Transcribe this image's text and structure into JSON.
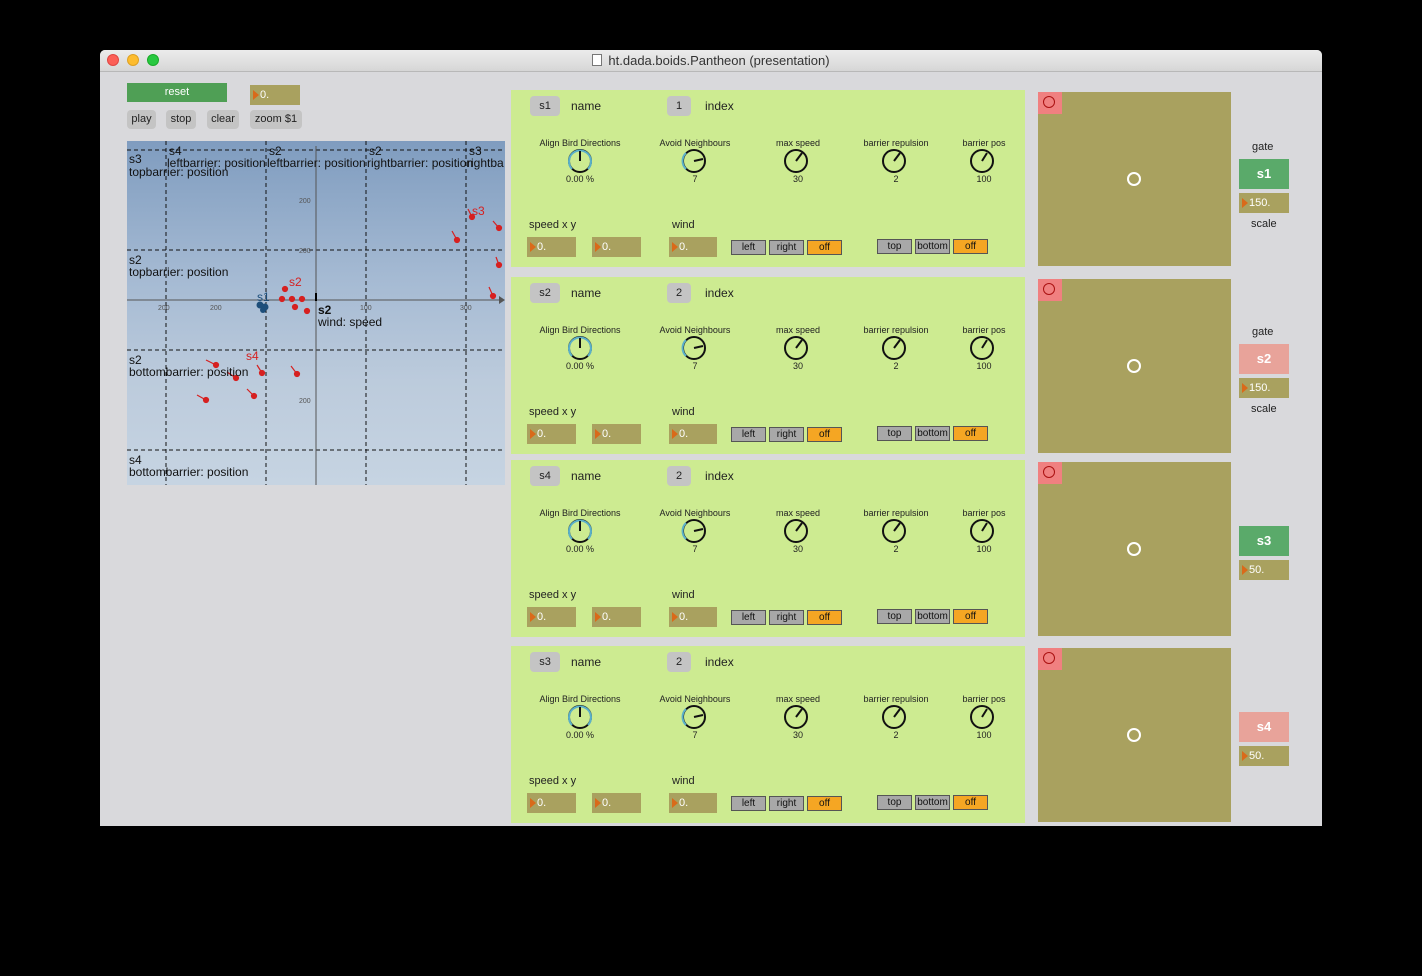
{
  "window": {
    "title": "ht.dada.boids.Pantheon (presentation)"
  },
  "controls": {
    "reset": "reset",
    "value": "0.",
    "play": "play",
    "stop": "stop",
    "clear": "clear",
    "zoom": "zoom $1"
  },
  "map": {
    "labels": {
      "s3_top": "s3",
      "s4_top": "s4",
      "s2_top_a": "s2",
      "s2_top_b": "s2",
      "s3_top_b": "s3",
      "topbarrier": "topbarrier: position",
      "leftbarrier_a": "leftbarrier: position",
      "leftbarrier_b": "leftbarrier: position",
      "rightbarrier_a": "rightbarrier: position",
      "rightbarrier_b": "rightba",
      "s2_mid": "s2",
      "topbarrier_2": "topbarrier: position",
      "s2_low": "s2",
      "bottombarrier": "bottombarrier: position",
      "s4_low": "s4",
      "bottombarrier_2": "bottombarrier: position",
      "wind_s2": "s2",
      "wind": "wind: speed",
      "red_s3": "s3",
      "red_s2": "s2",
      "red_s4": "s4",
      "blue_s1": "s1"
    },
    "ticks": [
      "200",
      "200",
      "200",
      "100",
      "200",
      "300",
      "200",
      "200",
      "100"
    ]
  },
  "common": {
    "name_label": "name",
    "index_label": "index",
    "align_label": "Align Bird Directions",
    "avoid_label": "Avoid Neighbours",
    "maxspeed_label": "max speed",
    "repulsion_label": "barrier repulsion",
    "barrierpos_label": "barrier pos",
    "speed_label": "speed x y",
    "wind_label": "wind",
    "left": "left",
    "right": "right",
    "off": "off",
    "top": "top",
    "bottom": "bottom"
  },
  "panels": [
    {
      "name": "s1",
      "index": "1",
      "align": "0.00 %",
      "avoid": "7",
      "maxspeed": "30",
      "repulsion": "2",
      "barrierpos": "100",
      "speed_x": "0.",
      "speed_y": "0.",
      "wind": "0."
    },
    {
      "name": "s2",
      "index": "2",
      "align": "0.00 %",
      "avoid": "7",
      "maxspeed": "30",
      "repulsion": "2",
      "barrierpos": "100",
      "speed_x": "0.",
      "speed_y": "0.",
      "wind": "0."
    },
    {
      "name": "s4",
      "index": "2",
      "align": "0.00 %",
      "avoid": "7",
      "maxspeed": "30",
      "repulsion": "2",
      "barrierpos": "100",
      "speed_x": "0.",
      "speed_y": "0.",
      "wind": "0."
    },
    {
      "name": "s3",
      "index": "2",
      "align": "0.00 %",
      "avoid": "7",
      "maxspeed": "30",
      "repulsion": "2",
      "barrierpos": "100",
      "speed_x": "0.",
      "speed_y": "0.",
      "wind": "0."
    }
  ],
  "gates": [
    {
      "label": "s1",
      "value": "150.",
      "color": "#5aaa6a",
      "gate_label": "gate",
      "scale_label": "scale"
    },
    {
      "label": "s2",
      "value": "150.",
      "color": "#e8a39a",
      "gate_label": "gate",
      "scale_label": "scale"
    },
    {
      "label": "s3",
      "value": "50.",
      "color": "#5aaa6a"
    },
    {
      "label": "s4",
      "value": "50.",
      "color": "#e8a39a"
    }
  ]
}
